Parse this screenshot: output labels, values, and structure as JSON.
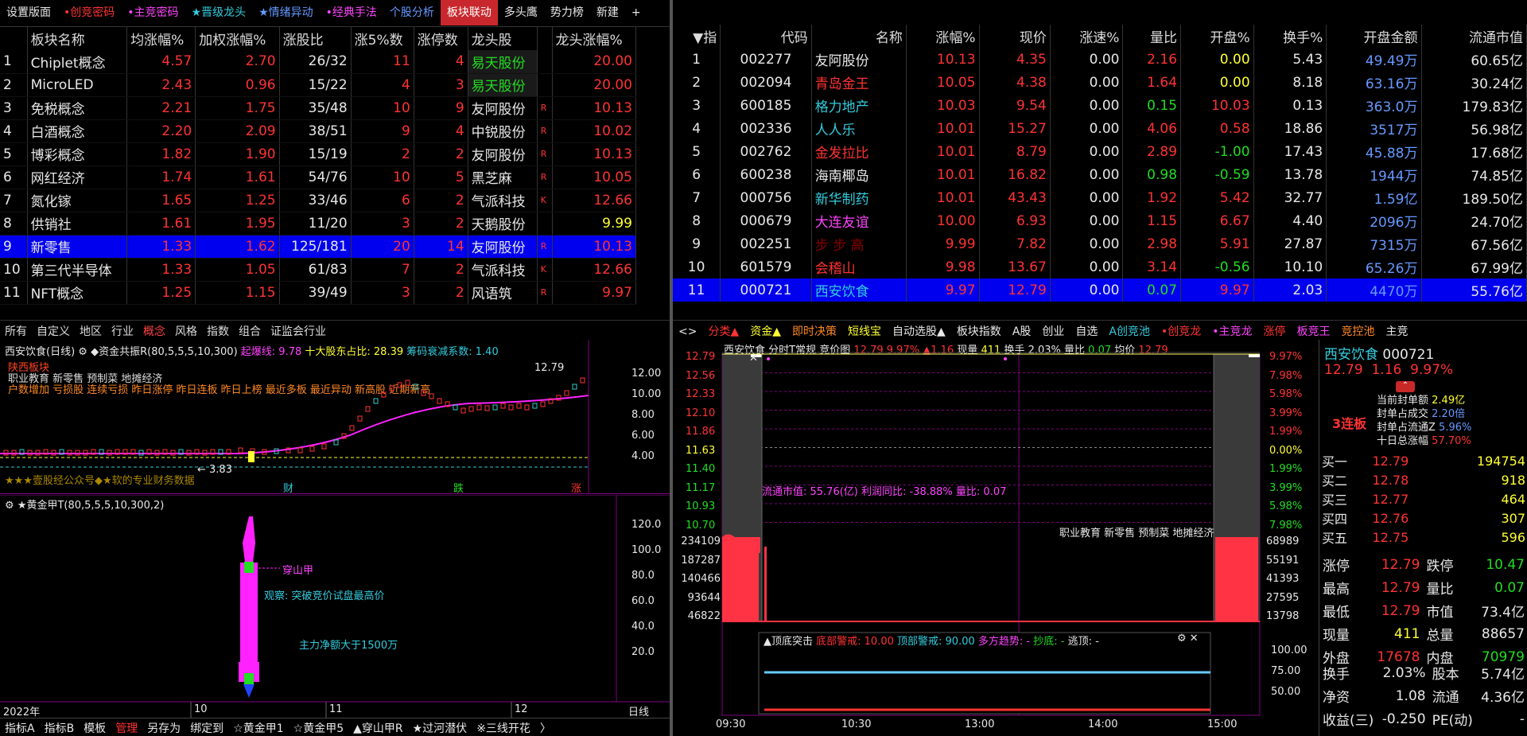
{
  "top_tabs": [
    {
      "label": "设置版面",
      "cls": "w"
    },
    {
      "label": "•创竞密码",
      "cls": "r"
    },
    {
      "label": "•主竞密码",
      "cls": "m"
    },
    {
      "label": "★晋级龙头",
      "cls": "c"
    },
    {
      "label": "★情绪异动",
      "cls": "b"
    },
    {
      "label": "•经典手法",
      "cls": "m"
    },
    {
      "label": "个股分析",
      "cls": "b"
    },
    {
      "label": "板块联动",
      "cls": "act"
    },
    {
      "label": "多头鹰",
      "cls": "w"
    },
    {
      "label": "势力榜",
      "cls": "w"
    },
    {
      "label": "新建",
      "cls": "w"
    },
    {
      "label": "+",
      "cls": "w"
    }
  ],
  "sector": {
    "headers": [
      "",
      "板块名称",
      "均涨幅%",
      "加权涨幅%",
      "涨股比",
      "涨5%数",
      "涨停数",
      "龙头股",
      "",
      "龙头涨幅%"
    ],
    "rows": [
      [
        "1",
        "Chiplet概念",
        "4.57",
        "2.70",
        "26/32",
        "11",
        "4",
        "易天股份",
        "",
        "20.00"
      ],
      [
        "2",
        "MicroLED",
        "2.43",
        "0.96",
        "15/22",
        "4",
        "3",
        "易天股份",
        "",
        "20.00"
      ],
      [
        "3",
        "免税概念",
        "2.21",
        "1.75",
        "35/48",
        "10",
        "9",
        "友阿股份",
        "R",
        "10.13"
      ],
      [
        "4",
        "白酒概念",
        "2.20",
        "2.09",
        "38/51",
        "9",
        "4",
        "中锐股份",
        "R",
        "10.02"
      ],
      [
        "5",
        "博彩概念",
        "1.82",
        "1.90",
        "15/19",
        "2",
        "2",
        "友阿股份",
        "R",
        "10.13"
      ],
      [
        "6",
        "网红经济",
        "1.74",
        "1.61",
        "54/76",
        "10",
        "5",
        "黑芝麻",
        "R",
        "10.05"
      ],
      [
        "7",
        "氮化镓",
        "1.65",
        "1.25",
        "33/46",
        "6",
        "2",
        "气派科技",
        "K",
        "12.66"
      ],
      [
        "8",
        "供销社",
        "1.61",
        "1.95",
        "11/20",
        "3",
        "2",
        "天鹅股份",
        "",
        "9.99"
      ],
      [
        "9",
        "新零售",
        "1.33",
        "1.62",
        "125/181",
        "20",
        "14",
        "友阿股份",
        "R",
        "10.13"
      ],
      [
        "10",
        "第三代半导体",
        "1.33",
        "1.05",
        "61/83",
        "7",
        "2",
        "气派科技",
        "K",
        "12.66"
      ],
      [
        "11",
        "NFT概念",
        "1.25",
        "1.15",
        "39/49",
        "3",
        "2",
        "风语筑",
        "R",
        "9.97"
      ]
    ]
  },
  "stocks": {
    "headers": [
      "▼指",
      "代码",
      "名称",
      "涨幅%",
      "现价",
      "涨速%",
      "量比",
      "开盘%",
      "换手%",
      "开盘金额",
      "流通市值"
    ],
    "rows": [
      [
        "1",
        "002277",
        "友阿股份",
        "10.13",
        "4.35",
        "0.00",
        "2.16",
        "0.00",
        "5.43",
        "49.49万",
        "60.65亿"
      ],
      [
        "2",
        "002094",
        "青岛金王",
        "10.05",
        "4.38",
        "0.00",
        "1.64",
        "0.00",
        "8.18",
        "63.16万",
        "30.24亿"
      ],
      [
        "3",
        "600185",
        "格力地产",
        "10.03",
        "9.54",
        "0.00",
        "0.15",
        "10.03",
        "0.13",
        "363.0万",
        "179.83亿"
      ],
      [
        "4",
        "002336",
        "人人乐",
        "10.01",
        "15.27",
        "0.00",
        "4.06",
        "0.58",
        "18.86",
        "3517万",
        "56.98亿"
      ],
      [
        "5",
        "002762",
        "金发拉比",
        "10.01",
        "8.79",
        "0.00",
        "2.89",
        "-1.00",
        "17.43",
        "45.88万",
        "17.68亿"
      ],
      [
        "6",
        "600238",
        "海南椰岛",
        "10.01",
        "16.82",
        "0.00",
        "0.98",
        "-0.59",
        "13.78",
        "1944万",
        "74.85亿"
      ],
      [
        "7",
        "000756",
        "新华制药",
        "10.01",
        "43.43",
        "0.00",
        "1.92",
        "5.42",
        "32.77",
        "1.59亿",
        "189.50亿"
      ],
      [
        "8",
        "000679",
        "大连友谊",
        "10.00",
        "6.93",
        "0.00",
        "1.15",
        "6.67",
        "4.40",
        "2096万",
        "24.70亿"
      ],
      [
        "9",
        "002251",
        "步 步 高",
        "9.99",
        "7.82",
        "0.00",
        "2.98",
        "5.91",
        "27.87",
        "7315万",
        "67.56亿"
      ],
      [
        "10",
        "601579",
        "会稽山",
        "9.98",
        "13.67",
        "0.00",
        "3.14",
        "-0.56",
        "10.10",
        "65.26万",
        "67.99亿"
      ],
      [
        "11",
        "000721",
        "西安饮食",
        "9.97",
        "12.79",
        "0.00",
        "0.07",
        "9.97",
        "2.03",
        "4470万",
        "55.76亿"
      ]
    ]
  },
  "k_tabs": [
    "所有",
    "自定义",
    "地区",
    "行业",
    "概念",
    "风格",
    "指数",
    "组合",
    "证监会行业"
  ],
  "r_tabs": [
    "<>",
    "分类▲",
    "资金▲",
    "即时决策",
    "短线宝",
    "自动选股▲",
    "板块指数",
    "A股",
    "创业",
    "自选",
    "A创竞池",
    "•创竞龙",
    "•主竞龙",
    "涨停",
    "板竞王",
    "竞控池",
    "主竞"
  ],
  "kchart": {
    "title": "西安饮食(日线)",
    "indicator": "◆资金共振R(80,5,5,5,10,300)",
    "qibao": "起爆线: 9.78",
    "holders": "十大股东占比: 28.39",
    "chip": "筹码衰减系数: 1.40",
    "tag1": "陕西板块",
    "tags2": "职业教育 新零售 预制菜 地摊经济",
    "tags3": "户数增加 亏损股 连续亏损 昨日涨停 昨日连板 昨日上榜 最近多板 最近异动 新高股 近期新高",
    "last_price": "12.79",
    "low_label": "← 3.83",
    "watermark": "★★★壹股经公众号◆★软的专业财务数据",
    "y_ticks": [
      "12.00",
      "10.00",
      "8.00",
      "6.00",
      "4.00"
    ],
    "markers": [
      "财",
      "跌",
      "涨"
    ]
  },
  "ind2": {
    "title": "★黄金甲T(80,5,5,5,10,300,2)",
    "ticks": [
      "120.0",
      "100.0",
      "80.0",
      "60.0",
      "40.0",
      "20.0"
    ],
    "label1": "穿山甲",
    "label2": "观察:  突破竞价试盘最高价",
    "label3": "主力净额大于1500万",
    "dates": [
      "2022年",
      "10",
      "11",
      "12",
      "日线"
    ]
  },
  "bottom_tabs": [
    "指标A",
    "指标B",
    "模板",
    "管理",
    "另存为",
    "绑定到",
    "☆黄金甲1",
    "☆黄金甲5",
    "▲穿山甲R",
    "★过河潜伏",
    "※三线开花",
    "〉"
  ],
  "intraday": {
    "header": {
      "name": "西安饮食",
      "mode": "分时T常规",
      "aux": "竞价图",
      "price": "12.79",
      "pct": "9.97%",
      "chg": "▲1.16",
      "vol_label": "现量",
      "vol": "411",
      "turn": "换手 2.03%",
      "qr_label": "量比",
      "qr": "0.07",
      "avg_label": "均价",
      "avg": "12.79"
    },
    "left_ticks": [
      "12.79",
      "12.56",
      "12.33",
      "12.10",
      "11.86",
      "11.63",
      "11.40",
      "11.17",
      "10.93",
      "10.70"
    ],
    "right_ticks": [
      "9.97%",
      "7.98%",
      "5.98%",
      "3.99%",
      "1.99%",
      "0.00%",
      "1.99%",
      "3.99%",
      "5.98%",
      "7.98%"
    ],
    "vol_left": [
      "234109",
      "187287",
      "140466",
      "93644",
      "46822"
    ],
    "vol_right": [
      "68989",
      "55191",
      "41393",
      "27595",
      "13798"
    ],
    "info": "流通市值: 55.76(亿)  利润同比: -38.88%  量比: 0.07",
    "concepts": "职业教育 新零售 预制菜 地摊经济",
    "sub_title": "▲顶底突击",
    "sub_low": "底部警戒: 10.00",
    "sub_high": "顶部警戒: 90.00",
    "sub_trend": "多方趋势: -",
    "sub_draw": "抄底: -",
    "sub_escape": "逃顶: -",
    "sub_ticks": [
      "100.00",
      "75.00",
      "50.00"
    ],
    "times": [
      "09:30",
      "10:30",
      "13:00",
      "14:00",
      "15:00"
    ]
  },
  "quote": {
    "name": "西安饮食",
    "code": "000721",
    "price": "12.79",
    "chg": "1.16",
    "pct": "9.97%",
    "streak": "3连板",
    "seal": [
      [
        "当前封单额",
        "2.49亿"
      ],
      [
        "封单占成交",
        "2.20倍"
      ],
      [
        "封单占流通Z",
        "5.96%"
      ],
      [
        "十日总涨幅",
        "57.70%"
      ]
    ],
    "buys": [
      [
        "买一",
        "12.79",
        "194754"
      ],
      [
        "买二",
        "12.78",
        "918"
      ],
      [
        "买三",
        "12.77",
        "464"
      ],
      [
        "买四",
        "12.76",
        "307"
      ],
      [
        "买五",
        "12.75",
        "596"
      ]
    ],
    "stats": [
      [
        "涨停",
        "12.79",
        "跌停",
        "10.47"
      ],
      [
        "最高",
        "12.79",
        "量比",
        "0.07"
      ],
      [
        "最低",
        "12.79",
        "市值",
        "73.4亿"
      ],
      [
        "现量",
        "411",
        "总量",
        "88657"
      ],
      [
        "外盘",
        "17678",
        "内盘",
        "70979"
      ]
    ],
    "stats2": [
      [
        "换手",
        "2.03%",
        "股本",
        "5.74亿"
      ],
      [
        "净资",
        "1.08",
        "流通",
        "4.36亿"
      ],
      [
        "收益(三)",
        "-0.250",
        "PE(动)",
        "-"
      ]
    ]
  },
  "colors": {
    "up": "#ff3333",
    "down": "#22dd22",
    "select": "#0000ee",
    "magenta": "#ff33ff",
    "cyan": "#33ccdd"
  }
}
